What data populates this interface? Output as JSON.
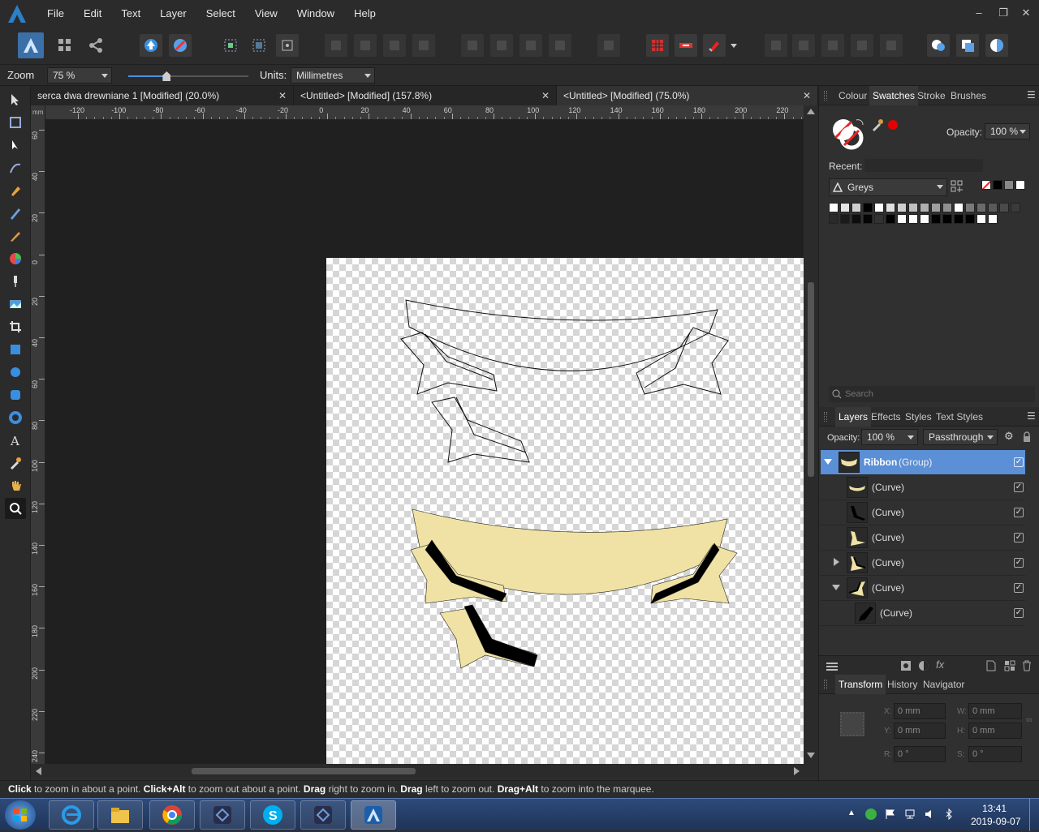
{
  "menu": {
    "items": [
      "File",
      "Edit",
      "Text",
      "Layer",
      "Select",
      "View",
      "Window",
      "Help"
    ]
  },
  "window": {
    "minimize": "‒",
    "restore": "❐",
    "close": "✕"
  },
  "context": {
    "zoom_label": "Zoom",
    "zoom_value": "75 %",
    "units_label": "Units:",
    "units_value": "Millimetres",
    "zoom_slider": 0.32
  },
  "tabs": [
    {
      "label": "serca dwa drewniane 1 [Modified] (20.0%)",
      "close": "✕"
    },
    {
      "label": "<Untitled> [Modified] (157.8%)",
      "close": "✕"
    },
    {
      "label": "<Untitled> [Modified] (75.0%)",
      "close": "✕"
    }
  ],
  "ruler": {
    "h": [
      "-120",
      "-100",
      "-80",
      "-60",
      "-40",
      "-20",
      "0",
      "20",
      "40",
      "60",
      "80",
      "100",
      "120",
      "140",
      "160",
      "180",
      "200",
      "220"
    ],
    "v": [
      "60",
      "40",
      "20",
      "0",
      "20",
      "40",
      "60",
      "80",
      "100",
      "120",
      "140",
      "160",
      "180",
      "200",
      "220",
      "240"
    ],
    "unit": "mm"
  },
  "colors": {
    "accent": "#2d7fc7",
    "ribbon_fill": "#efe2a4",
    "layer_selected": "#5b8fd6"
  },
  "swatches": {
    "tabs": [
      "Colour",
      "Swatches",
      "Stroke",
      "Brushes"
    ],
    "opacity_label": "Opacity:",
    "opacity_value": "100 %",
    "recent_label": "Recent:",
    "palette": "Greys",
    "row1": [
      "#ffffff",
      "#e6e6e6",
      "#d0d0d0",
      "#000000",
      "#ffffff",
      "#e0e0e0",
      "#cfcfcf",
      "#bfbfbf",
      "#afafaf",
      "#9f9f9f",
      "#8f8f8f",
      "#ffffff",
      "#7a7a7a",
      "#6a6a6a",
      "#5a5a5a",
      "#4a4a4a",
      "#3a3a3a"
    ],
    "row2": [
      "#2a2a2a",
      "#1a1a1a",
      "#0d0d0d",
      "#050505",
      "#333333",
      "#000000",
      "#ffffff",
      "#ffffff",
      "#ffffff",
      "#000000",
      "#000000",
      "#000000",
      "#000000",
      "#ffffff",
      "#ffffff"
    ]
  },
  "search": {
    "placeholder": "Search"
  },
  "layers": {
    "tabs": [
      "Layers",
      "Effects",
      "Styles",
      "Text Styles"
    ],
    "opacity_label": "Opacity:",
    "opacity_value": "100 %",
    "blend": "Passthrough",
    "rows": [
      {
        "name": "Ribbon",
        "suffix": "(Group)",
        "expanded": true,
        "selected": true
      },
      {
        "name": "(Curve)"
      },
      {
        "name": "(Curve)"
      },
      {
        "name": "(Curve)"
      },
      {
        "name": "(Curve)",
        "collapsed": true
      },
      {
        "name": "(Curve)",
        "expanded": true
      },
      {
        "name": "(Curve)",
        "child": true
      }
    ]
  },
  "transform": {
    "tabs": [
      "Transform",
      "History",
      "Navigator"
    ],
    "x_label": "X:",
    "x_value": "0 mm",
    "w_label": "W:",
    "w_value": "0 mm",
    "y_label": "Y:",
    "y_value": "0 mm",
    "h_label": "H:",
    "h_value": "0 mm",
    "r_label": "R:",
    "r_value": "0 °",
    "s_label": "S:",
    "s_value": "0 °"
  },
  "status": {
    "parts": [
      {
        "b": "Click",
        "t": " to zoom in about a point. "
      },
      {
        "b": "Click+Alt",
        "t": " to zoom out about a point. "
      },
      {
        "b": "Drag",
        "t": " right to zoom in. "
      },
      {
        "b": "Drag",
        "t": " left to zoom out. "
      },
      {
        "b": "Drag+Alt",
        "t": " to zoom into the marquee."
      }
    ]
  },
  "taskbar": {
    "time": "13:41",
    "date": "2019-09-07"
  }
}
